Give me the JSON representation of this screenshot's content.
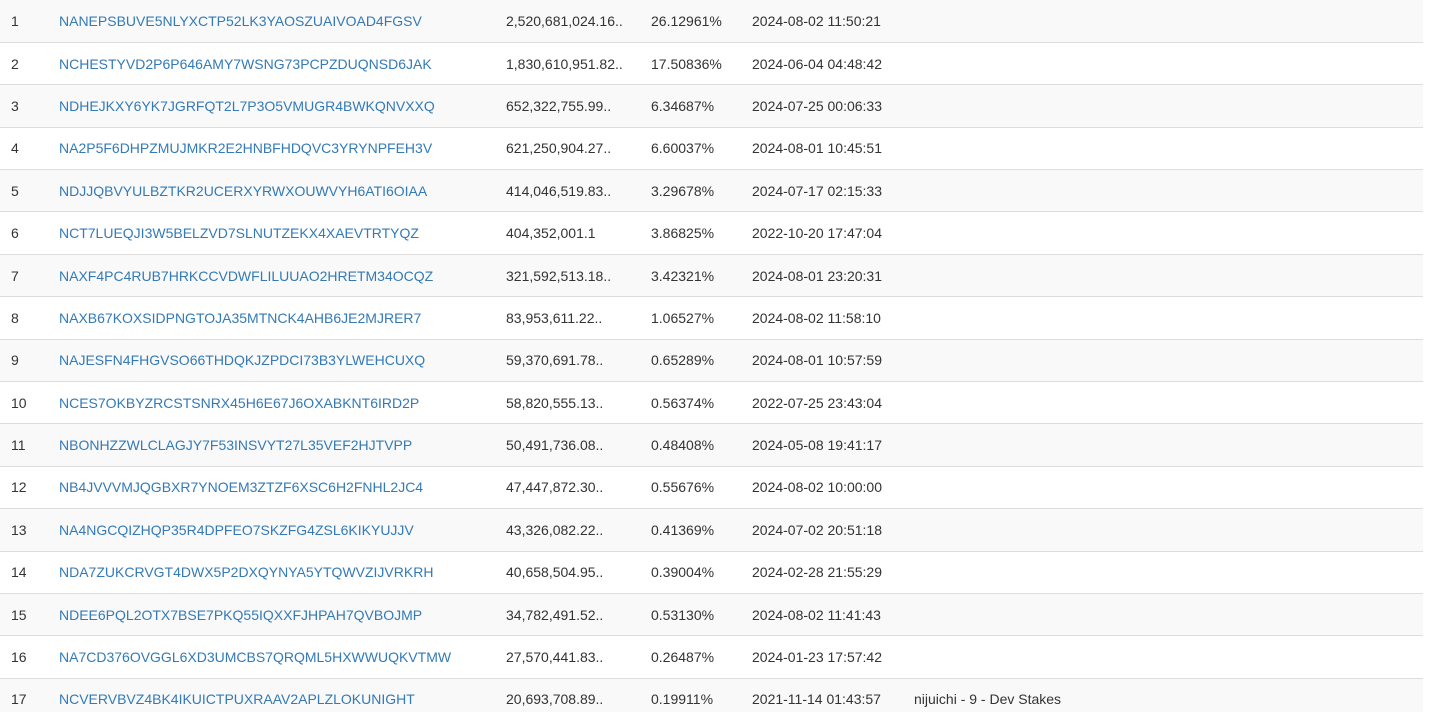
{
  "table": {
    "rows": [
      {
        "rank": "1",
        "address": "NANEPSBUVE5NLYXCTP52LK3YAOSZUAIVOAD4FGSV",
        "balance": "2,520,681,024.16..",
        "percent": "26.12961%",
        "timestamp": "2024-08-02 11:50:21",
        "label": ""
      },
      {
        "rank": "2",
        "address": "NCHESTYVD2P6P646AMY7WSNG73PCPZDUQNSD6JAK",
        "balance": "1,830,610,951.82..",
        "percent": "17.50836%",
        "timestamp": "2024-06-04 04:48:42",
        "label": ""
      },
      {
        "rank": "3",
        "address": "NDHEJKXY6YK7JGRFQT2L7P3O5VMUGR4BWKQNVXXQ",
        "balance": "652,322,755.99..",
        "percent": "6.34687%",
        "timestamp": "2024-07-25 00:06:33",
        "label": ""
      },
      {
        "rank": "4",
        "address": "NA2P5F6DHPZMUJMKR2E2HNBFHDQVC3YRYNPFEH3V",
        "balance": "621,250,904.27..",
        "percent": "6.60037%",
        "timestamp": "2024-08-01 10:45:51",
        "label": ""
      },
      {
        "rank": "5",
        "address": "NDJJQBVYULBZTKR2UCERXYRWXOUWVYH6ATI6OIAA",
        "balance": "414,046,519.83..",
        "percent": "3.29678%",
        "timestamp": "2024-07-17 02:15:33",
        "label": ""
      },
      {
        "rank": "6",
        "address": "NCT7LUEQJI3W5BELZVD7SLNUTZEKX4XAEVTRTYQZ",
        "balance": "404,352,001.1",
        "percent": "3.86825%",
        "timestamp": "2022-10-20 17:47:04",
        "label": ""
      },
      {
        "rank": "7",
        "address": "NAXF4PC4RUB7HRKCCVDWFLILUUAO2HRETM34OCQZ",
        "balance": "321,592,513.18..",
        "percent": "3.42321%",
        "timestamp": "2024-08-01 23:20:31",
        "label": ""
      },
      {
        "rank": "8",
        "address": "NAXB67KOXSIDPNGTOJA35MTNCK4AHB6JE2MJRER7",
        "balance": "83,953,611.22..",
        "percent": "1.06527%",
        "timestamp": "2024-08-02 11:58:10",
        "label": ""
      },
      {
        "rank": "9",
        "address": "NAJESFN4FHGVSO66THDQKJZPDCI73B3YLWEHCUXQ",
        "balance": "59,370,691.78..",
        "percent": "0.65289%",
        "timestamp": "2024-08-01 10:57:59",
        "label": ""
      },
      {
        "rank": "10",
        "address": "NCES7OKBYZRCSTSNRX45H6E67J6OXABKNT6IRD2P",
        "balance": "58,820,555.13..",
        "percent": "0.56374%",
        "timestamp": "2022-07-25 23:43:04",
        "label": ""
      },
      {
        "rank": "11",
        "address": "NBONHZZWLCLAGJY7F53INSVYT27L35VEF2HJTVPP",
        "balance": "50,491,736.08..",
        "percent": "0.48408%",
        "timestamp": "2024-05-08 19:41:17",
        "label": ""
      },
      {
        "rank": "12",
        "address": "NB4JVVVMJQGBXR7YNOEM3ZTZF6XSC6H2FNHL2JC4",
        "balance": "47,447,872.30..",
        "percent": "0.55676%",
        "timestamp": "2024-08-02 10:00:00",
        "label": ""
      },
      {
        "rank": "13",
        "address": "NA4NGCQIZHQP35R4DPFEO7SKZFG4ZSL6KIKYUJJV",
        "balance": "43,326,082.22..",
        "percent": "0.41369%",
        "timestamp": "2024-07-02 20:51:18",
        "label": ""
      },
      {
        "rank": "14",
        "address": "NDA7ZUKCRVGT4DWX5P2DXQYNYA5YTQWVZIJVRKRH",
        "balance": "40,658,504.95..",
        "percent": "0.39004%",
        "timestamp": "2024-02-28 21:55:29",
        "label": ""
      },
      {
        "rank": "15",
        "address": "NDEE6PQL2OTX7BSE7PKQ55IQXXFJHPAH7QVBOJMP",
        "balance": "34,782,491.52..",
        "percent": "0.53130%",
        "timestamp": "2024-08-02 11:41:43",
        "label": ""
      },
      {
        "rank": "16",
        "address": "NA7CD376OVGGL6XD3UMCBS7QRQML5HXWWUQKVTMW",
        "balance": "27,570,441.83..",
        "percent": "0.26487%",
        "timestamp": "2024-01-23 17:57:42",
        "label": ""
      },
      {
        "rank": "17",
        "address": "NCVERVBVZ4BK4IKUICTPUXRAAV2APLZLOKUNIGHT",
        "balance": "20,693,708.89..",
        "percent": "0.19911%",
        "timestamp": "2021-11-14 01:43:57",
        "label": "nijuichi - 9 - Dev Stakes"
      }
    ]
  },
  "colors": {
    "link": "#337ab7",
    "text": "#333333",
    "stripe": "#f9f9f9",
    "border": "#dddddd"
  }
}
